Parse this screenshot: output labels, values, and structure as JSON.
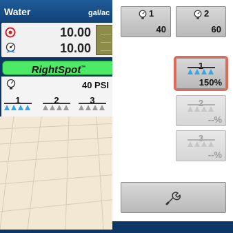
{
  "left_panel": {
    "product_name": "Water",
    "unit": "gal/ac",
    "target_rate": "10.00",
    "actual_rate": "10.00",
    "rightspot_label": "RightSpot",
    "rightspot_mark": "™",
    "pressure": "40 PSI",
    "sections": [
      {
        "number": "1",
        "active": true
      },
      {
        "number": "2",
        "active": false
      },
      {
        "number": "3",
        "active": false
      }
    ]
  },
  "right_panel": {
    "pressure_buttons": [
      {
        "number": "1",
        "value": "40"
      },
      {
        "number": "2",
        "value": "60"
      }
    ],
    "nozzle_buttons": [
      {
        "number": "1",
        "value": "150%",
        "enabled": true,
        "selected": true
      },
      {
        "number": "2",
        "value": "--%",
        "enabled": false
      },
      {
        "number": "3",
        "value": "--%",
        "enabled": false
      }
    ],
    "settings_icon": "wrench-icon"
  },
  "colors": {
    "header_blue": "#1f5c99",
    "rightspot_green": "#4cea66",
    "highlight": "#e26a55",
    "nozzle_blue": "#33a7e6"
  }
}
